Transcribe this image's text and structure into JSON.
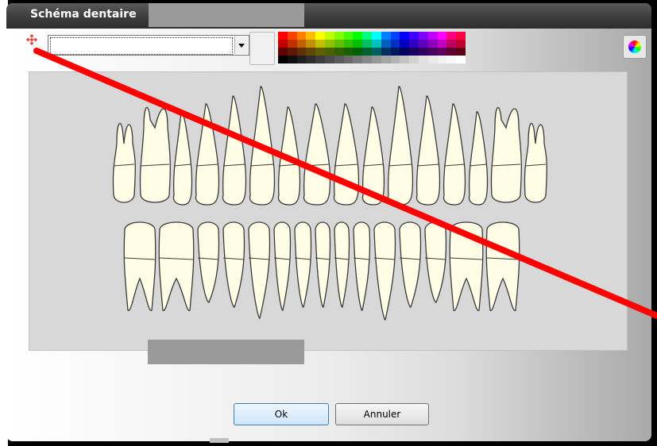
{
  "dialog": {
    "title": "Schéma dentaire"
  },
  "toolbar": {
    "combo_value": "",
    "palette_colors": [
      "#ff0000",
      "#ff4000",
      "#ff8000",
      "#ffbf00",
      "#ffff00",
      "#bfff00",
      "#80ff00",
      "#40ff00",
      "#00ff00",
      "#00ff80",
      "#00ffff",
      "#0080ff",
      "#0040ff",
      "#0000ff",
      "#4000ff",
      "#8000ff",
      "#bf00ff",
      "#ff00ff",
      "#ff0080",
      "#ff0040",
      "#c00000",
      "#c03000",
      "#c06000",
      "#c09000",
      "#c0c000",
      "#90c000",
      "#60c000",
      "#30c000",
      "#00c000",
      "#00c060",
      "#00c0c0",
      "#0060c0",
      "#0030c0",
      "#0000c0",
      "#3000c0",
      "#6000c0",
      "#9000c0",
      "#c000c0",
      "#c00060",
      "#c00030",
      "#600000",
      "#601800",
      "#603000",
      "#604800",
      "#606000",
      "#486000",
      "#306000",
      "#186000",
      "#006000",
      "#006030",
      "#006060",
      "#003060",
      "#001860",
      "#000060",
      "#180060",
      "#300060",
      "#480060",
      "#600060",
      "#600030",
      "#600018",
      "#000000",
      "#0f0f0f",
      "#1e1e1e",
      "#2d2d2d",
      "#3c3c3c",
      "#4b4b4b",
      "#5a5a5a",
      "#696969",
      "#787878",
      "#878787",
      "#969696",
      "#a5a5a5",
      "#b4b4b4",
      "#c3c3c3",
      "#d2d2d2",
      "#e1e1e1",
      "#eaeaea",
      "#f2f2f2",
      "#f8f8f8",
      "#ffffff"
    ]
  },
  "buttons": {
    "ok": "Ok",
    "cancel": "Annuler"
  },
  "colors": {
    "tooth_fill": "#fffde6",
    "tooth_stroke": "#3a3a3a",
    "annotation": "#ff0000",
    "chart_bg": "#d8d8d8"
  }
}
